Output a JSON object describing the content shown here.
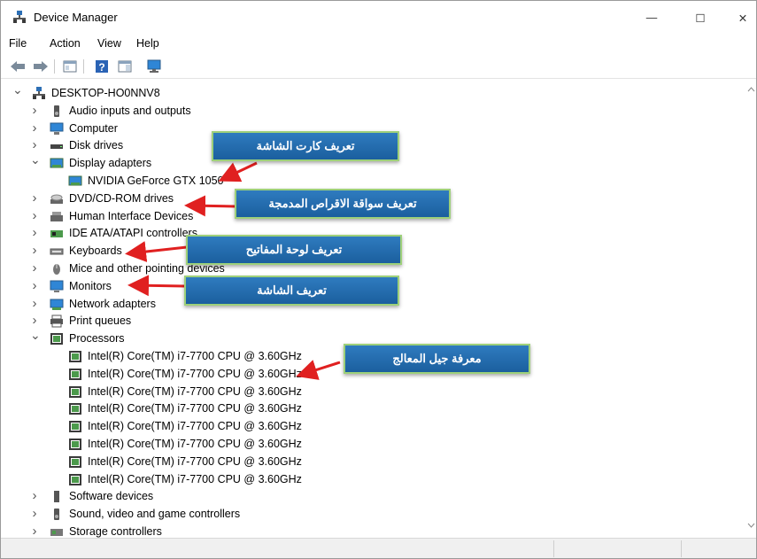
{
  "window": {
    "title": "Device Manager",
    "controls": {
      "minimize": "—",
      "maximize": "☐",
      "close": "✕"
    }
  },
  "menu": [
    "File",
    "Action",
    "View",
    "Help"
  ],
  "toolbar_icons": [
    "back-arrow-icon",
    "forward-arrow-icon",
    "properties-icon",
    "help-icon",
    "details-pane-icon",
    "monitor-scan-icon"
  ],
  "tree": {
    "root": "DESKTOP-HO0NNV8",
    "items": [
      {
        "label": "Audio inputs and outputs",
        "icon": "speaker-icon",
        "expanded": false
      },
      {
        "label": "Computer",
        "icon": "computer-icon",
        "expanded": false
      },
      {
        "label": "Disk drives",
        "icon": "disk-drive-icon",
        "expanded": false
      },
      {
        "label": "Display adapters",
        "icon": "display-adapter-icon",
        "expanded": true,
        "children": [
          "NVIDIA GeForce GTX 1050"
        ]
      },
      {
        "label": "DVD/CD-ROM drives",
        "icon": "dvd-drive-icon",
        "expanded": false
      },
      {
        "label": "Human Interface Devices",
        "icon": "hid-icon",
        "expanded": false
      },
      {
        "label": "IDE ATA/ATAPI controllers",
        "icon": "ide-controller-icon",
        "expanded": false
      },
      {
        "label": "Keyboards",
        "icon": "keyboard-icon",
        "expanded": false
      },
      {
        "label": "Mice and other pointing devices",
        "icon": "mouse-icon",
        "expanded": false
      },
      {
        "label": "Monitors",
        "icon": "monitor-icon",
        "expanded": false
      },
      {
        "label": "Network adapters",
        "icon": "network-adapter-icon",
        "expanded": false
      },
      {
        "label": "Print queues",
        "icon": "printer-icon",
        "expanded": false
      },
      {
        "label": "Processors",
        "icon": "processor-icon",
        "expanded": true,
        "children": [
          "Intel(R) Core(TM) i7-7700 CPU @ 3.60GHz",
          "Intel(R) Core(TM) i7-7700 CPU @ 3.60GHz",
          "Intel(R) Core(TM) i7-7700 CPU @ 3.60GHz",
          "Intel(R) Core(TM) i7-7700 CPU @ 3.60GHz",
          "Intel(R) Core(TM) i7-7700 CPU @ 3.60GHz",
          "Intel(R) Core(TM) i7-7700 CPU @ 3.60GHz",
          "Intel(R) Core(TM) i7-7700 CPU @ 3.60GHz",
          "Intel(R) Core(TM) i7-7700 CPU @ 3.60GHz"
        ]
      },
      {
        "label": "Software devices",
        "icon": "software-device-icon",
        "expanded": false
      },
      {
        "label": "Sound, video and game controllers",
        "icon": "sound-icon",
        "expanded": false
      },
      {
        "label": "Storage controllers",
        "icon": "storage-controller-icon",
        "expanded": false
      }
    ]
  },
  "callouts": [
    {
      "text": "تعريف كارت الشاشة",
      "target": "NVIDIA GeForce GTX 1050"
    },
    {
      "text": "تعريف سواقة الاقراص المدمجة",
      "target": "DVD/CD-ROM drives"
    },
    {
      "text": "تعريف لوحة المفاتيح",
      "target": "Keyboards"
    },
    {
      "text": "تعريف الشاشة",
      "target": "Monitors"
    },
    {
      "text": "معرفة جيل المعالج",
      "target": "Intel(R) Core(TM) i7-7700 CPU @ 3.60GHz"
    }
  ],
  "colors": {
    "callout_fill": "#1f66a8",
    "callout_border": "#9ed07a",
    "arrow": "#e02020",
    "selection": "#ffffff"
  }
}
